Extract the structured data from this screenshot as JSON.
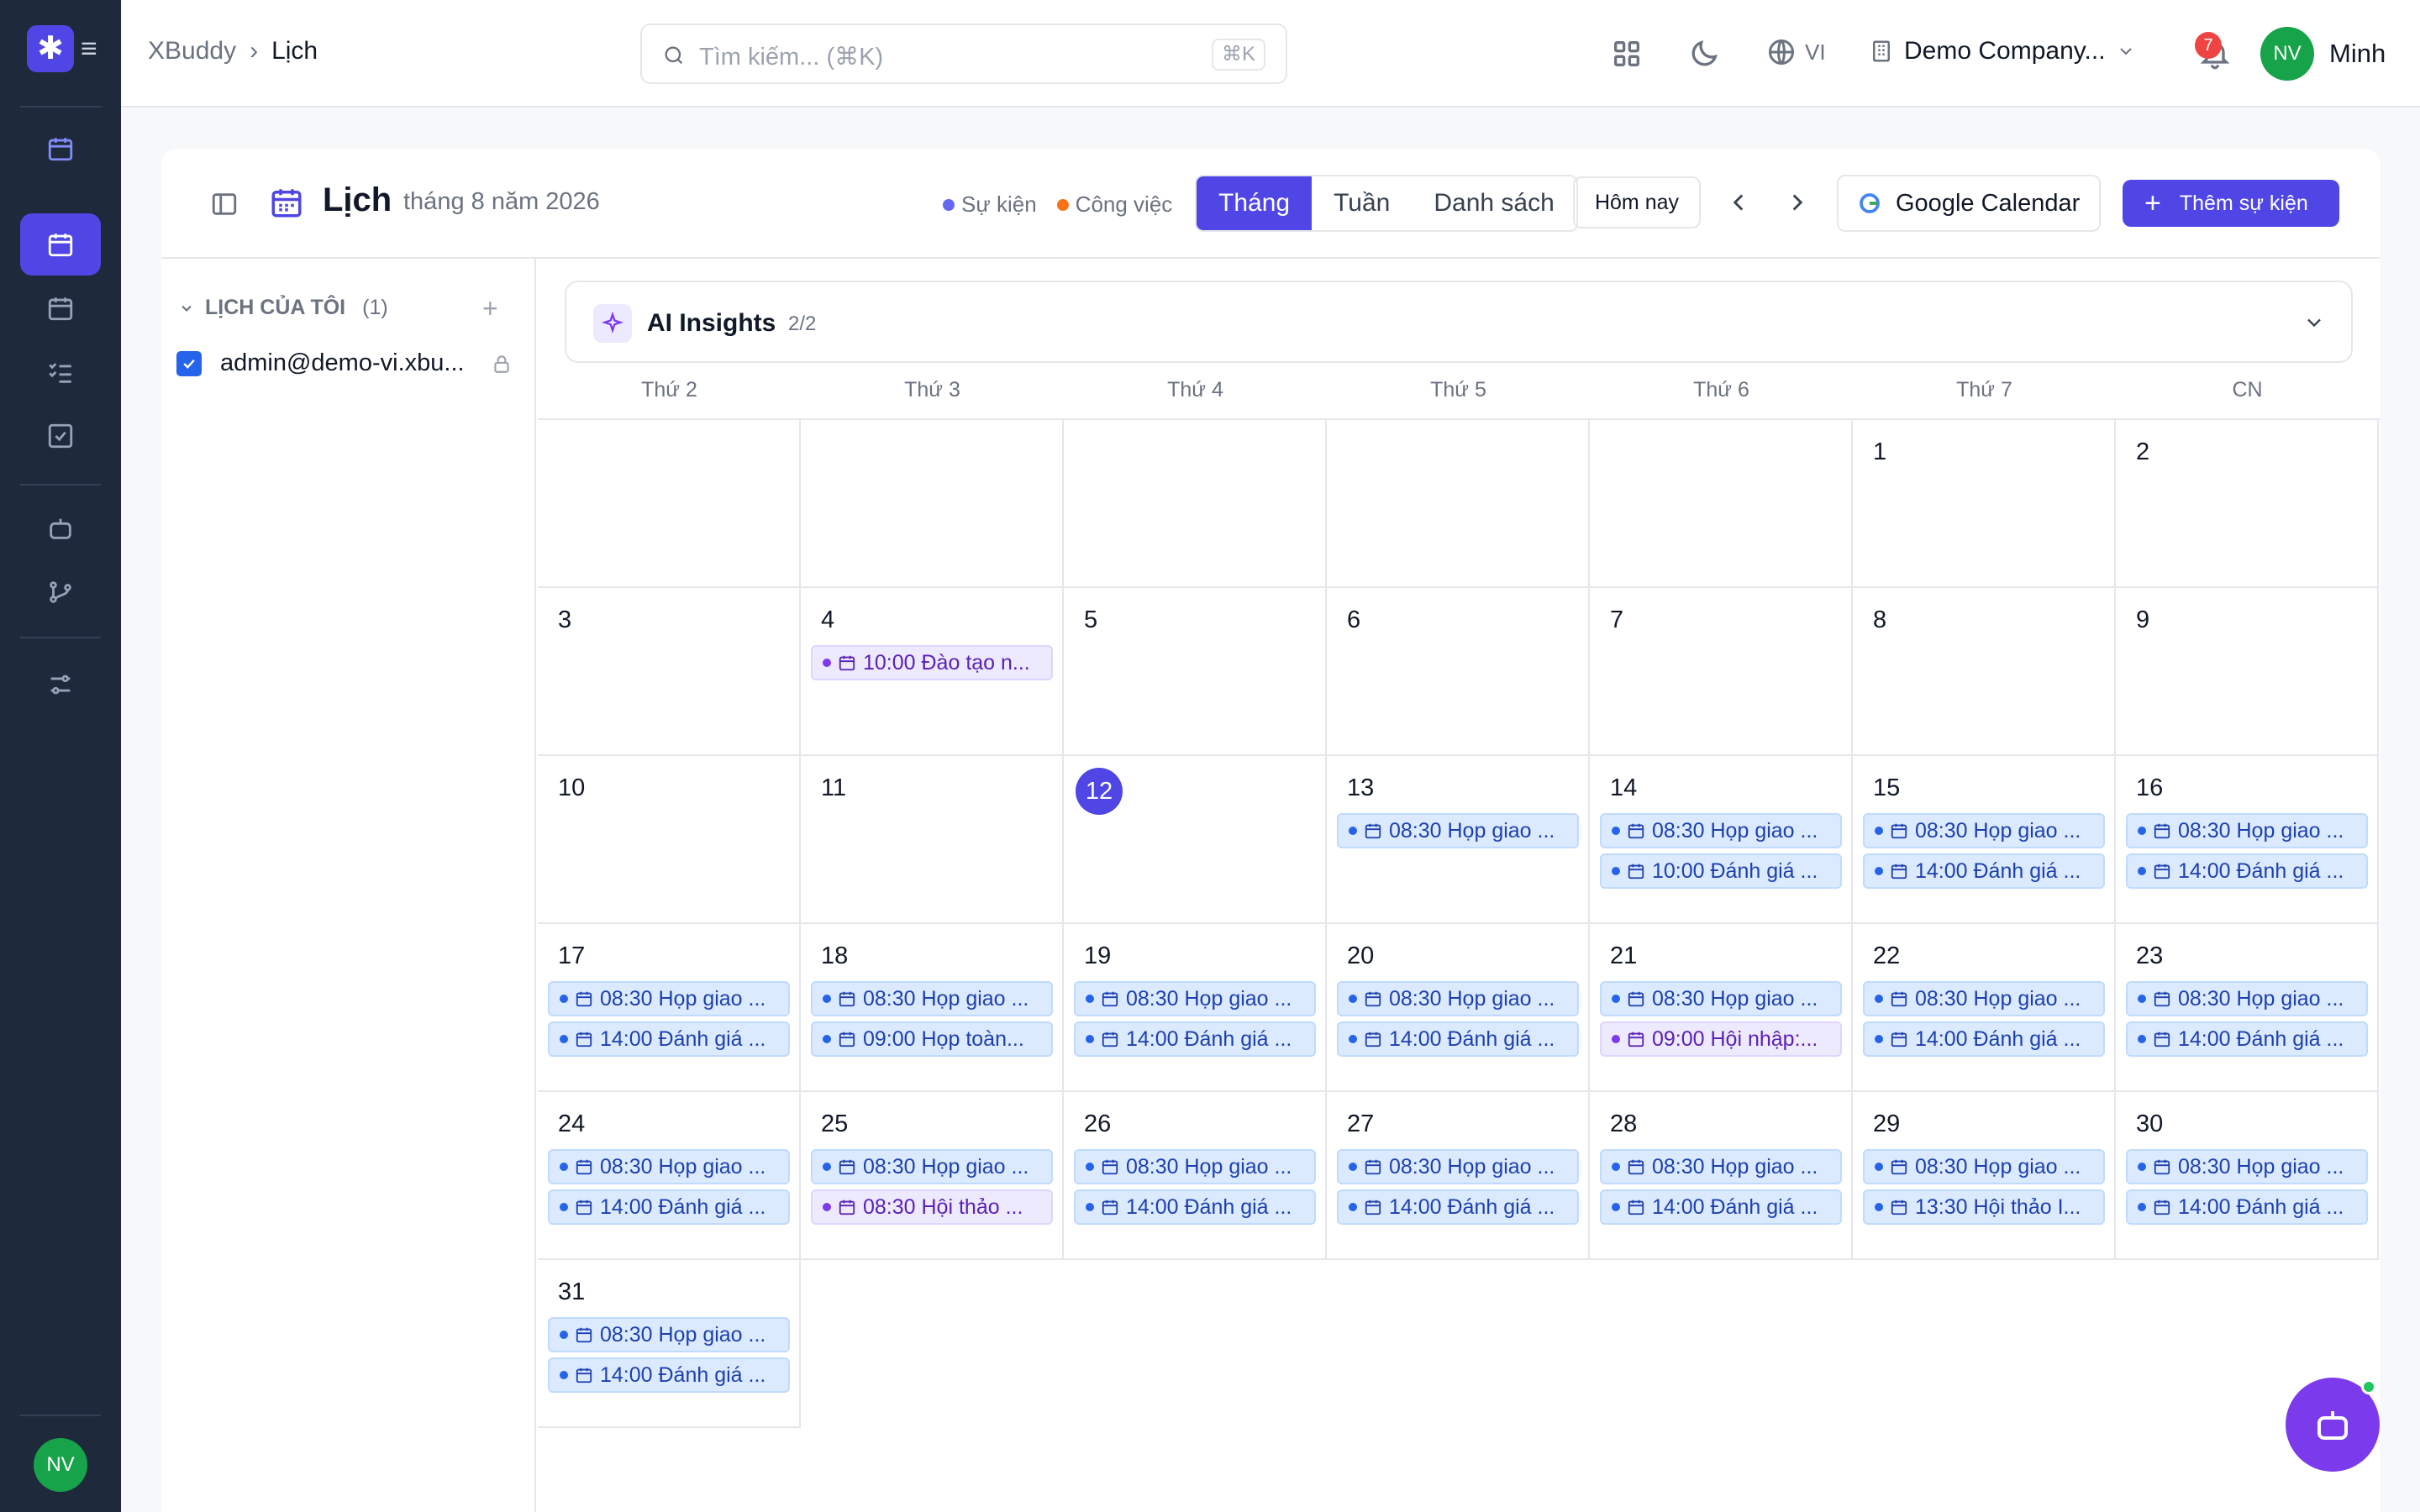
{
  "rail": {
    "avatar": "NV"
  },
  "header": {
    "breadcrumb": [
      "XBuddy",
      "Lịch"
    ],
    "search_placeholder": "Tìm kiếm... (⌘K)",
    "shortcut": "⌘K",
    "language": "VI",
    "company": "Demo Company...",
    "notification_count": "7",
    "user_initials": "NV",
    "user_name": "Minh"
  },
  "calendar": {
    "title": "Lịch",
    "subtitle": "tháng 8 năm 2026",
    "legend": [
      {
        "label": "Sự kiện",
        "color": "#6366f1"
      },
      {
        "label": "Công việc",
        "color": "#f97316"
      }
    ],
    "views": [
      "Tháng",
      "Tuần",
      "Danh sách"
    ],
    "active_view": "Tháng",
    "today_label": "Hôm nay",
    "google_label": "Google Calendar",
    "add_label": "Thêm sự kiện"
  },
  "sidebar": {
    "section_title": "LỊCH CỦA TÔI",
    "section_count": "(1)",
    "calendar_item": "admin@demo-vi.xbu..."
  },
  "insights": {
    "title": "AI Insights",
    "count": "2/2"
  },
  "weekdays": [
    "Thứ 2",
    "Thứ 3",
    "Thứ 4",
    "Thứ 5",
    "Thứ 6",
    "Thứ 7",
    "CN"
  ],
  "today": 12,
  "days": [
    {
      "d": "",
      "e": []
    },
    {
      "d": "",
      "e": []
    },
    {
      "d": "",
      "e": []
    },
    {
      "d": "",
      "e": []
    },
    {
      "d": "",
      "e": []
    },
    {
      "d": "1",
      "e": []
    },
    {
      "d": "2",
      "e": []
    },
    {
      "d": "3",
      "e": []
    },
    {
      "d": "4",
      "e": [
        {
          "t": "10:00 Đào tạo n...",
          "c": "p"
        }
      ]
    },
    {
      "d": "5",
      "e": []
    },
    {
      "d": "6",
      "e": []
    },
    {
      "d": "7",
      "e": []
    },
    {
      "d": "8",
      "e": []
    },
    {
      "d": "9",
      "e": []
    },
    {
      "d": "10",
      "e": []
    },
    {
      "d": "11",
      "e": []
    },
    {
      "d": "12",
      "e": []
    },
    {
      "d": "13",
      "e": [
        {
          "t": "08:30 Họp giao ...",
          "c": "b"
        }
      ]
    },
    {
      "d": "14",
      "e": [
        {
          "t": "08:30 Họp giao ...",
          "c": "b"
        },
        {
          "t": "10:00 Đánh giá ...",
          "c": "b"
        }
      ]
    },
    {
      "d": "15",
      "e": [
        {
          "t": "08:30 Họp giao ...",
          "c": "b"
        },
        {
          "t": "14:00 Đánh giá ...",
          "c": "b"
        }
      ]
    },
    {
      "d": "16",
      "e": [
        {
          "t": "08:30 Họp giao ...",
          "c": "b"
        },
        {
          "t": "14:00 Đánh giá ...",
          "c": "b"
        }
      ]
    },
    {
      "d": "17",
      "e": [
        {
          "t": "08:30 Họp giao ...",
          "c": "b"
        },
        {
          "t": "14:00 Đánh giá ...",
          "c": "b"
        }
      ]
    },
    {
      "d": "18",
      "e": [
        {
          "t": "08:30 Họp giao ...",
          "c": "b"
        },
        {
          "t": "09:00 Họp toàn...",
          "c": "b"
        }
      ]
    },
    {
      "d": "19",
      "e": [
        {
          "t": "08:30 Họp giao ...",
          "c": "b"
        },
        {
          "t": "14:00 Đánh giá ...",
          "c": "b"
        }
      ]
    },
    {
      "d": "20",
      "e": [
        {
          "t": "08:30 Họp giao ...",
          "c": "b"
        },
        {
          "t": "14:00 Đánh giá ...",
          "c": "b"
        }
      ]
    },
    {
      "d": "21",
      "e": [
        {
          "t": "08:30 Họp giao ...",
          "c": "b"
        },
        {
          "t": "09:00 Hội nhập:...",
          "c": "p"
        }
      ]
    },
    {
      "d": "22",
      "e": [
        {
          "t": "08:30 Họp giao ...",
          "c": "b"
        },
        {
          "t": "14:00 Đánh giá ...",
          "c": "b"
        }
      ]
    },
    {
      "d": "23",
      "e": [
        {
          "t": "08:30 Họp giao ...",
          "c": "b"
        },
        {
          "t": "14:00 Đánh giá ...",
          "c": "b"
        }
      ]
    },
    {
      "d": "24",
      "e": [
        {
          "t": "08:30 Họp giao ...",
          "c": "b"
        },
        {
          "t": "14:00 Đánh giá ...",
          "c": "b"
        }
      ]
    },
    {
      "d": "25",
      "e": [
        {
          "t": "08:30 Họp giao ...",
          "c": "b"
        },
        {
          "t": "08:30 Hội thảo ...",
          "c": "p"
        }
      ]
    },
    {
      "d": "26",
      "e": [
        {
          "t": "08:30 Họp giao ...",
          "c": "b"
        },
        {
          "t": "14:00 Đánh giá ...",
          "c": "b"
        }
      ]
    },
    {
      "d": "27",
      "e": [
        {
          "t": "08:30 Họp giao ...",
          "c": "b"
        },
        {
          "t": "14:00 Đánh giá ...",
          "c": "b"
        }
      ]
    },
    {
      "d": "28",
      "e": [
        {
          "t": "08:30 Họp giao ...",
          "c": "b"
        },
        {
          "t": "14:00 Đánh giá ...",
          "c": "b"
        }
      ]
    },
    {
      "d": "29",
      "e": [
        {
          "t": "08:30 Họp giao ...",
          "c": "b"
        },
        {
          "t": "13:30 Hội thảo I...",
          "c": "b"
        }
      ]
    },
    {
      "d": "30",
      "e": [
        {
          "t": "08:30 Họp giao ...",
          "c": "b"
        },
        {
          "t": "14:00 Đánh giá ...",
          "c": "b"
        }
      ]
    },
    {
      "d": "31",
      "e": [
        {
          "t": "08:30 Họp giao ...",
          "c": "b"
        },
        {
          "t": "14:00 Đánh giá ...",
          "c": "b"
        }
      ]
    }
  ]
}
